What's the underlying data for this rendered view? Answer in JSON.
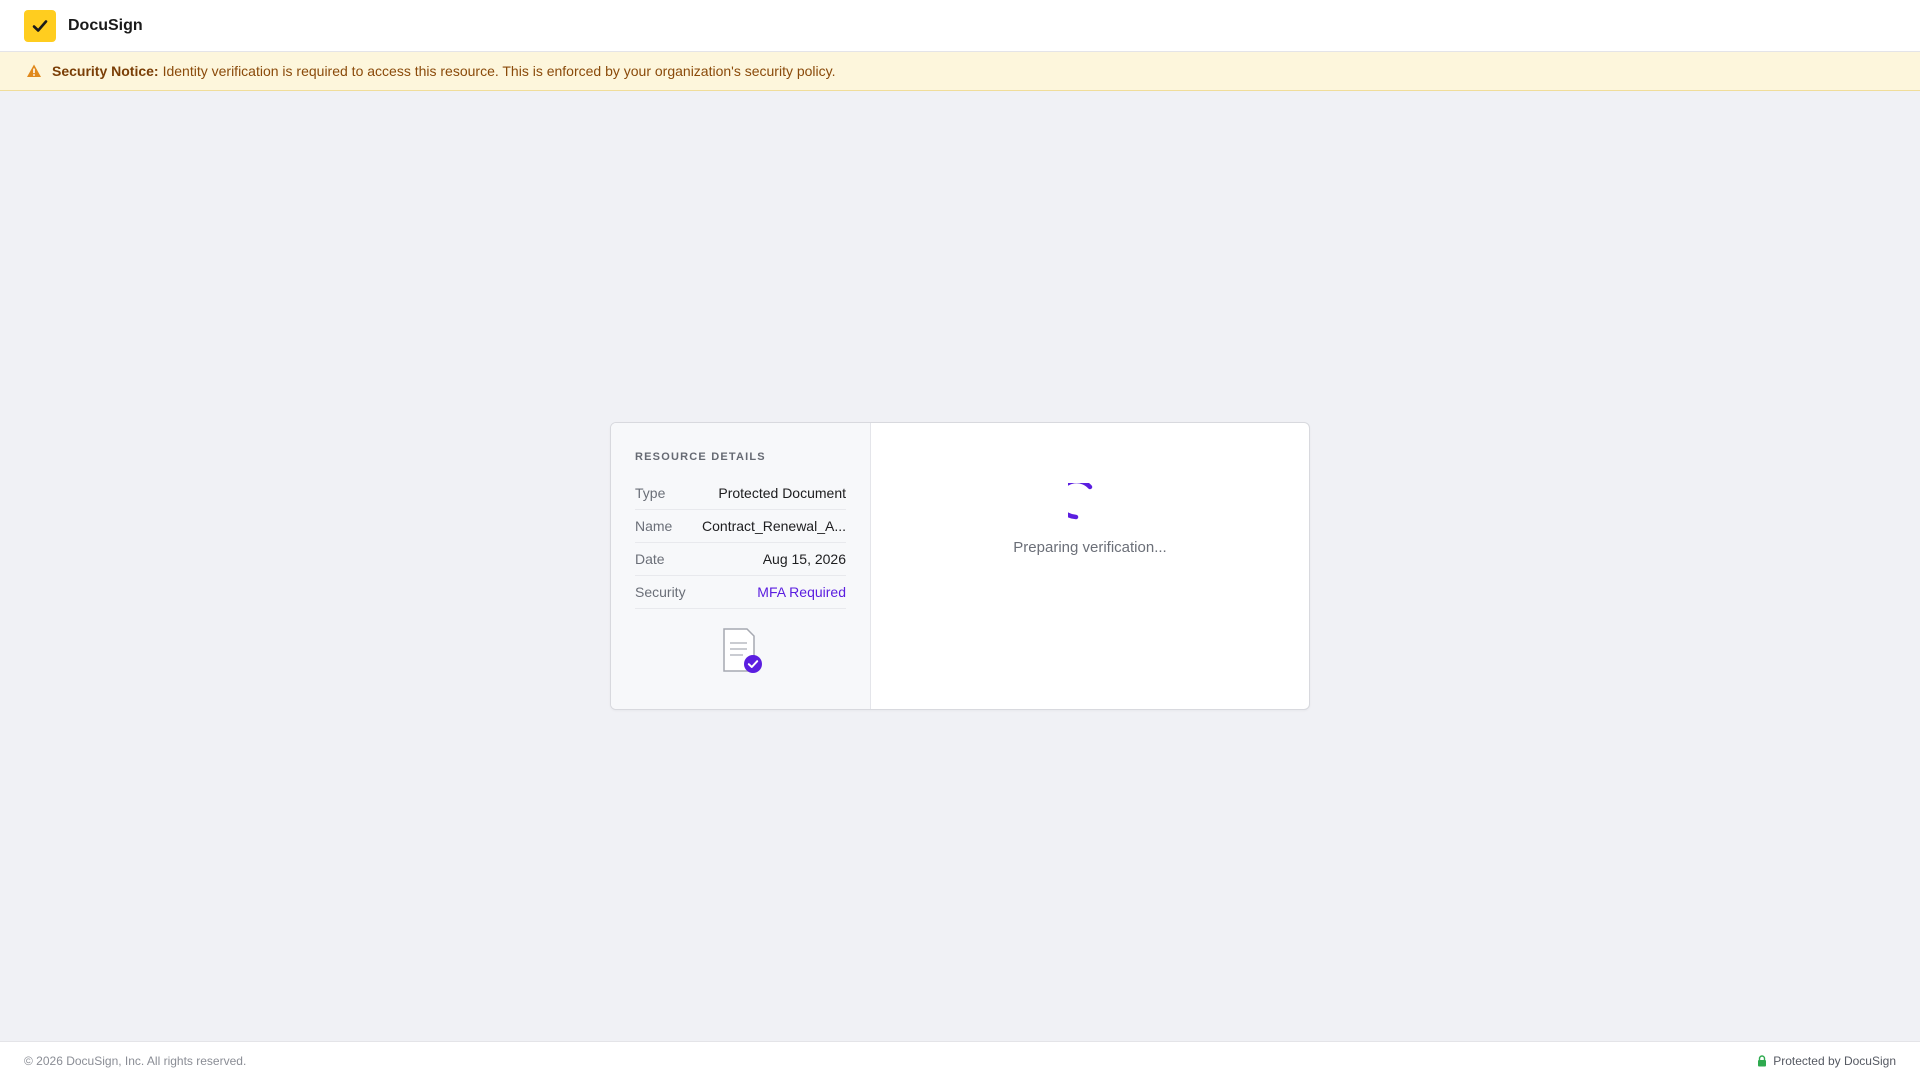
{
  "header": {
    "brand_name": "DocuSign",
    "logo_icon": "checkmark-icon"
  },
  "notice": {
    "label": "Security Notice:",
    "message": "Identity verification is required to access this resource. This is enforced by your organization's security policy.",
    "icon": "warning-icon"
  },
  "details": {
    "title": "RESOURCE DETAILS",
    "rows": [
      {
        "key": "Type",
        "value": "Protected Document"
      },
      {
        "key": "Name",
        "value": "Contract_Renewal_A..."
      },
      {
        "key": "Date",
        "value": "Aug 15, 2026"
      },
      {
        "key": "Security",
        "value": "MFA Required"
      }
    ],
    "icon": "document-check-icon"
  },
  "verification": {
    "status": "Preparing verification...",
    "icon": "spinner-icon"
  },
  "footer": {
    "copyright": "© 2026 DocuSign, Inc. All rights reserved.",
    "protected_label": "Protected by DocuSign",
    "icon": "lock-icon"
  },
  "colors": {
    "brand_yellow": "#ffcd1f",
    "accent_purple": "#5b1ee0",
    "notice_bg": "#fdf6dc",
    "secure_green": "#2eaa4f"
  }
}
